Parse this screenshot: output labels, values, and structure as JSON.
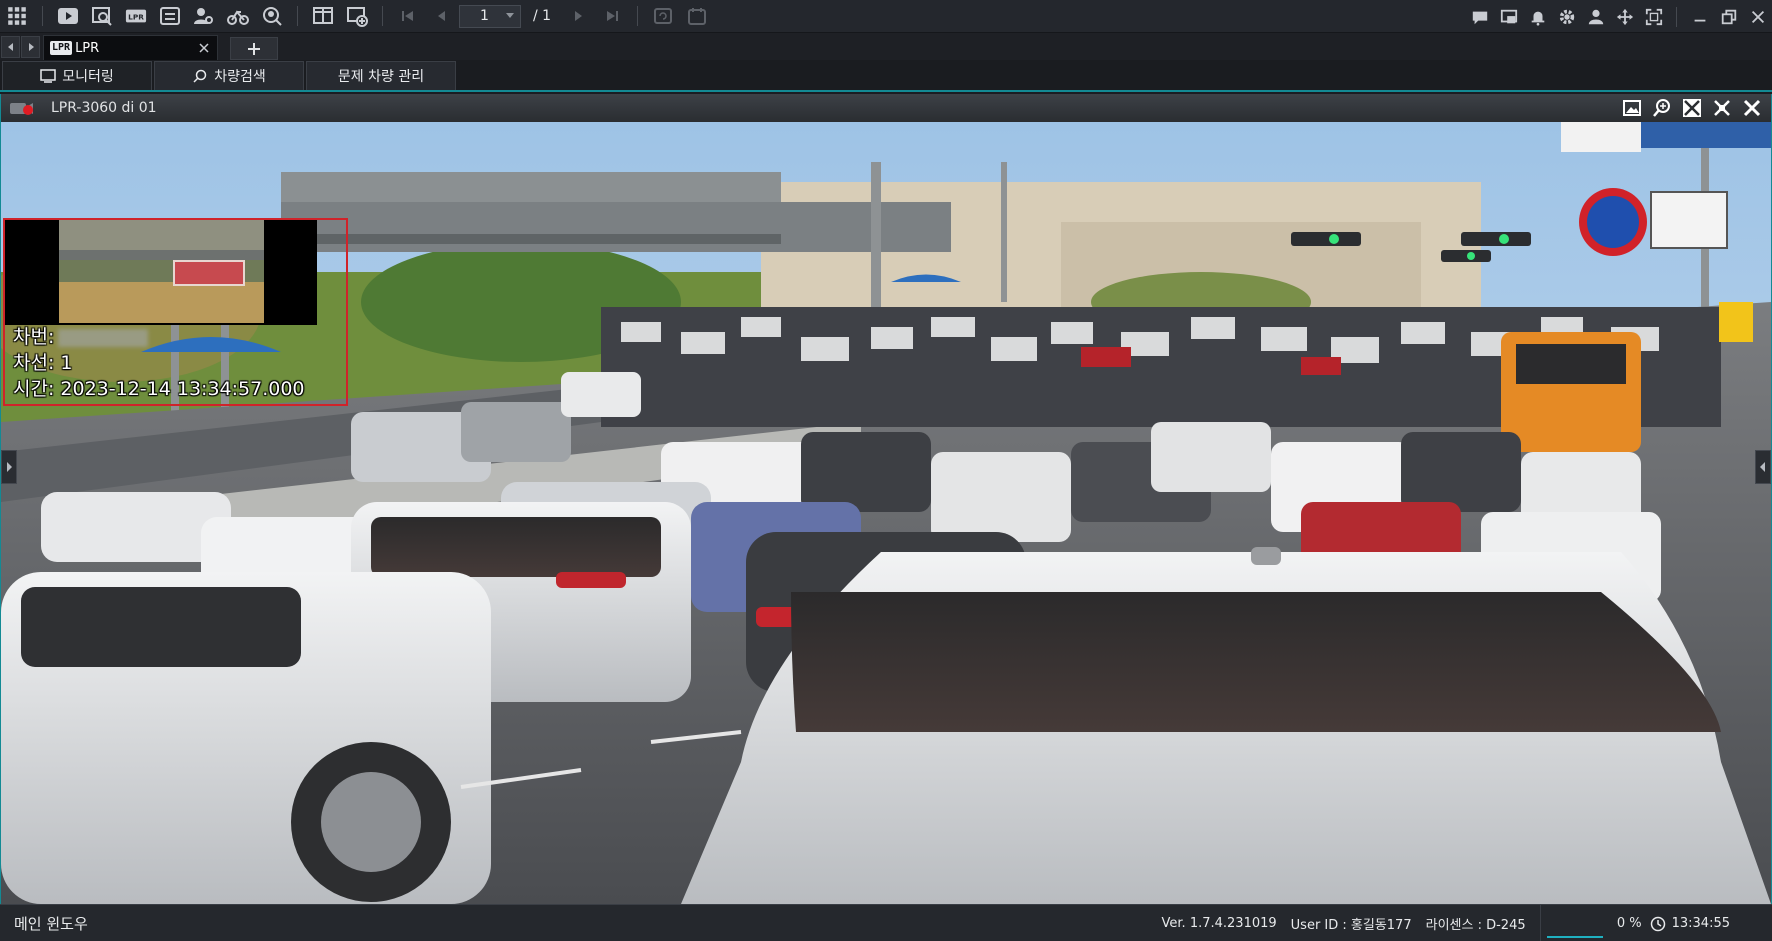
{
  "toolbar": {
    "page_current": "1",
    "page_total": "/ 1",
    "lpr_icon_label": "LPR"
  },
  "tabs": {
    "active_tab_badge": "LPR",
    "active_tab_label": "LPR"
  },
  "subtabs": [
    {
      "label": "모니터링",
      "icon": "monitor-icon"
    },
    {
      "label": "차량검색",
      "icon": "search-icon"
    },
    {
      "label": "문제 차량 관리",
      "icon": ""
    }
  ],
  "camera": {
    "name": "LPR-3060 di 01",
    "recording": true
  },
  "overlay": {
    "plate_label": "차번:",
    "lane_label": "차선: 1",
    "time_label": "시간: 2023-12-14 13:34:57.000"
  },
  "statusbar": {
    "window_name": "메인 윈도우",
    "version": "Ver. 1.7.4.231019",
    "user": "User ID : 홍길동177",
    "license": "라이센스 : D-245",
    "cpu": "0 %",
    "clock": "13:34:55"
  },
  "colors": {
    "accent": "#138a94",
    "alert": "#d0232a"
  }
}
